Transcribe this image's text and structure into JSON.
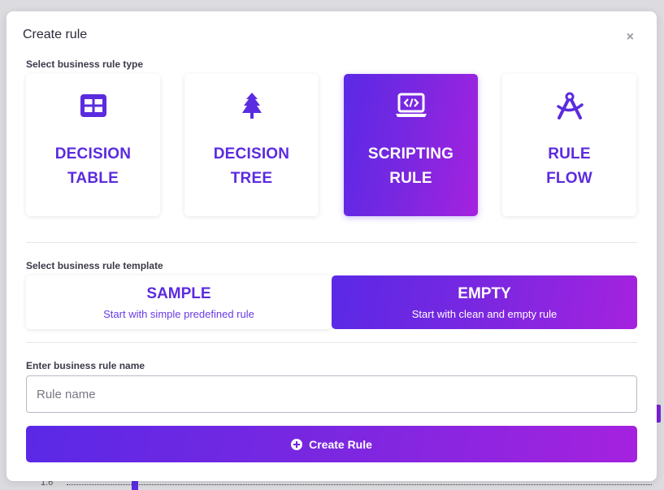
{
  "modal": {
    "title": "Create rule",
    "close_label": "×"
  },
  "rule_type": {
    "section_label": "Select business rule type",
    "options": [
      {
        "line1": "DECISION",
        "line2": "TABLE",
        "icon": "table-icon",
        "selected": false
      },
      {
        "line1": "DECISION",
        "line2": "TREE",
        "icon": "tree-icon",
        "selected": false
      },
      {
        "line1": "SCRIPTING",
        "line2": "RULE",
        "icon": "laptop-code-icon",
        "selected": true
      },
      {
        "line1": "RULE",
        "line2": "FLOW",
        "icon": "drafting-compass-icon",
        "selected": false
      }
    ]
  },
  "template": {
    "section_label": "Select business rule template",
    "options": [
      {
        "title": "SAMPLE",
        "subtitle": "Start with simple predefined rule",
        "selected": false
      },
      {
        "title": "EMPTY",
        "subtitle": "Start with clean and empty rule",
        "selected": true
      }
    ]
  },
  "name": {
    "label": "Enter business rule name",
    "placeholder": "Rule name",
    "value": ""
  },
  "create_button": {
    "label": "Create Rule",
    "icon": "plus-circle-icon"
  },
  "background": {
    "tick_label": "1.6"
  },
  "colors": {
    "accent": "#5b2be0",
    "gradient_start": "#5a29e6",
    "gradient_end": "#a522df"
  }
}
